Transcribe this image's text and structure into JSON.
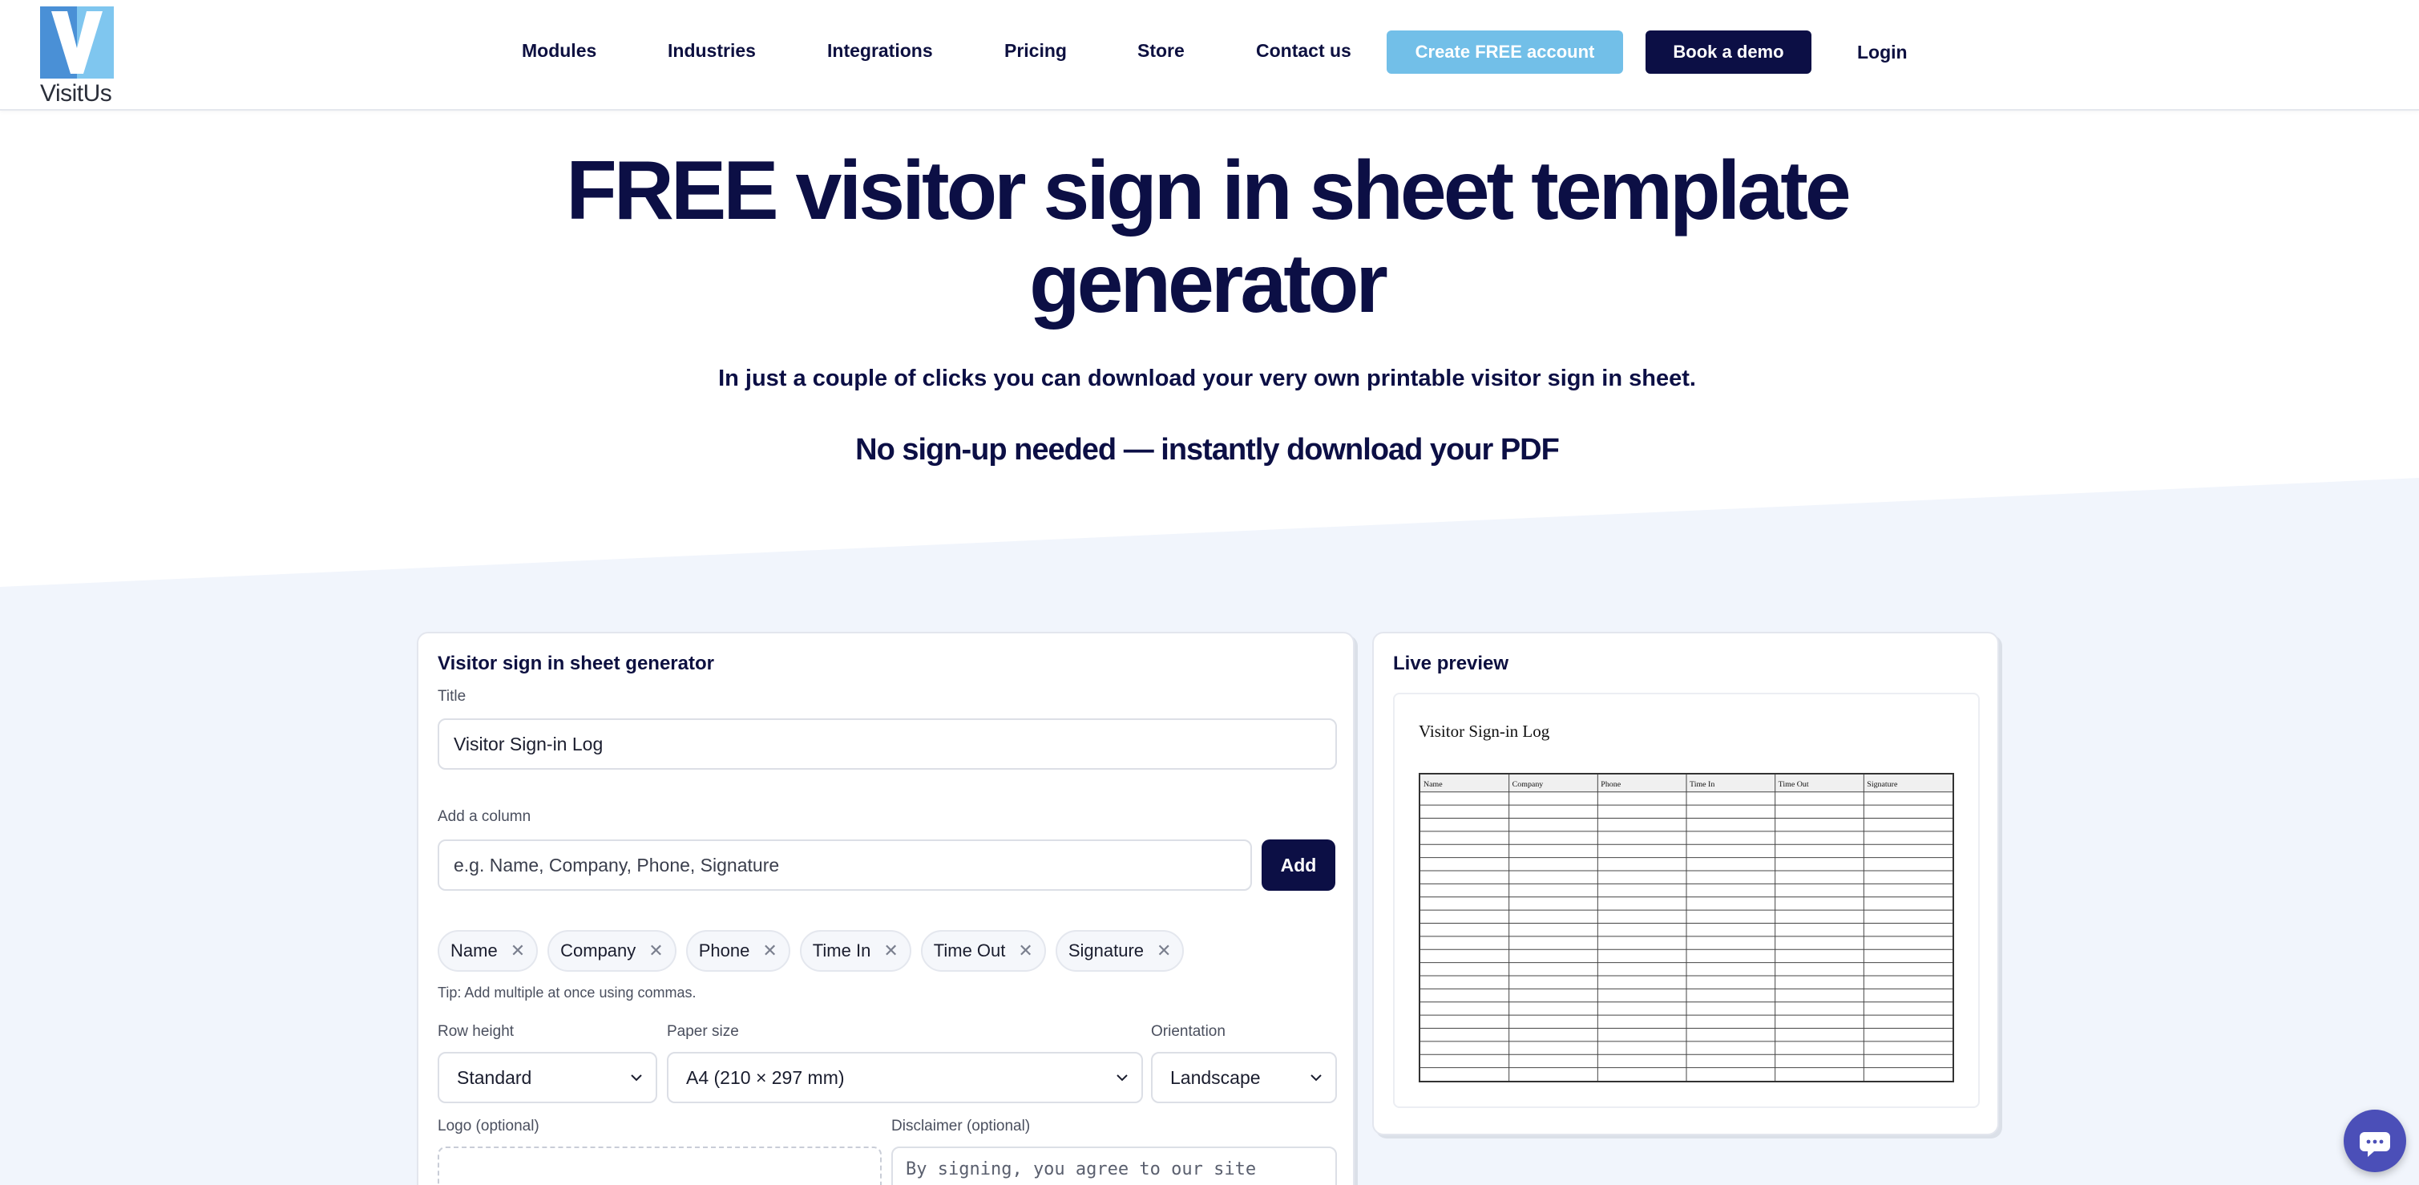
{
  "brand": {
    "name": "VisitUs",
    "colors": {
      "navy": "#0c0f45",
      "sky": "#72bfe8",
      "logo_dark": "#4a90d6",
      "logo_light": "#7fc6ef"
    }
  },
  "nav": {
    "items": [
      "Modules",
      "Industries",
      "Integrations",
      "Pricing",
      "Store",
      "Contact us"
    ],
    "create_account": "Create FREE account",
    "book_demo": "Book a demo",
    "login": "Login"
  },
  "hero": {
    "title_line1": "FREE visitor sign in sheet template",
    "title_line2": "generator",
    "subtitle": "In just a couple of clicks you can download your very own printable visitor sign in sheet.",
    "tagline": "No sign-up needed — instantly download your PDF"
  },
  "generator": {
    "heading": "Visitor sign in sheet generator",
    "title_label": "Title",
    "title_value": "Visitor Sign-in Log",
    "add_column_label": "Add a column",
    "add_column_placeholder": "e.g. Name, Company, Phone, Signature",
    "add_button": "Add",
    "columns": [
      "Name",
      "Company",
      "Phone",
      "Time In",
      "Time Out",
      "Signature"
    ],
    "tip": "Tip: Add multiple at once using commas.",
    "row_height_label": "Row height",
    "row_height_value": "Standard",
    "paper_size_label": "Paper size",
    "paper_size_value": "A4 (210 × 297 mm)",
    "orientation_label": "Orientation",
    "orientation_value": "Landscape",
    "logo_label": "Logo (optional)",
    "disclaimer_label": "Disclaimer (optional)",
    "disclaimer_placeholder": "By signing, you agree to our site rules."
  },
  "preview": {
    "heading": "Live preview",
    "sheet_title": "Visitor Sign-in Log",
    "columns": [
      "Name",
      "Company",
      "Phone",
      "Time In",
      "Time Out",
      "Signature"
    ],
    "row_count": 22
  },
  "icons": {
    "chip_remove": "close-icon",
    "select_chevron": "chevron-down-icon",
    "chat": "chat-icon"
  }
}
